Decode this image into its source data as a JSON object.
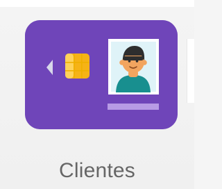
{
  "tile": {
    "label": "Clientes",
    "icon_name": "customer-card-icon",
    "colors": {
      "background": "#f4f4f4",
      "card": "#6f45b9",
      "card_text": "#666666",
      "chip": "#f6b316",
      "chip_highlight": "#ffd25a",
      "arrow": "#d8d8ea",
      "photo_frame": "#ffffff",
      "photo_bg": "#dff3f8",
      "skin": "#f2a55f",
      "hair": "#2e2e2e",
      "shirt": "#188f8f",
      "signature": "#b79be5"
    }
  }
}
